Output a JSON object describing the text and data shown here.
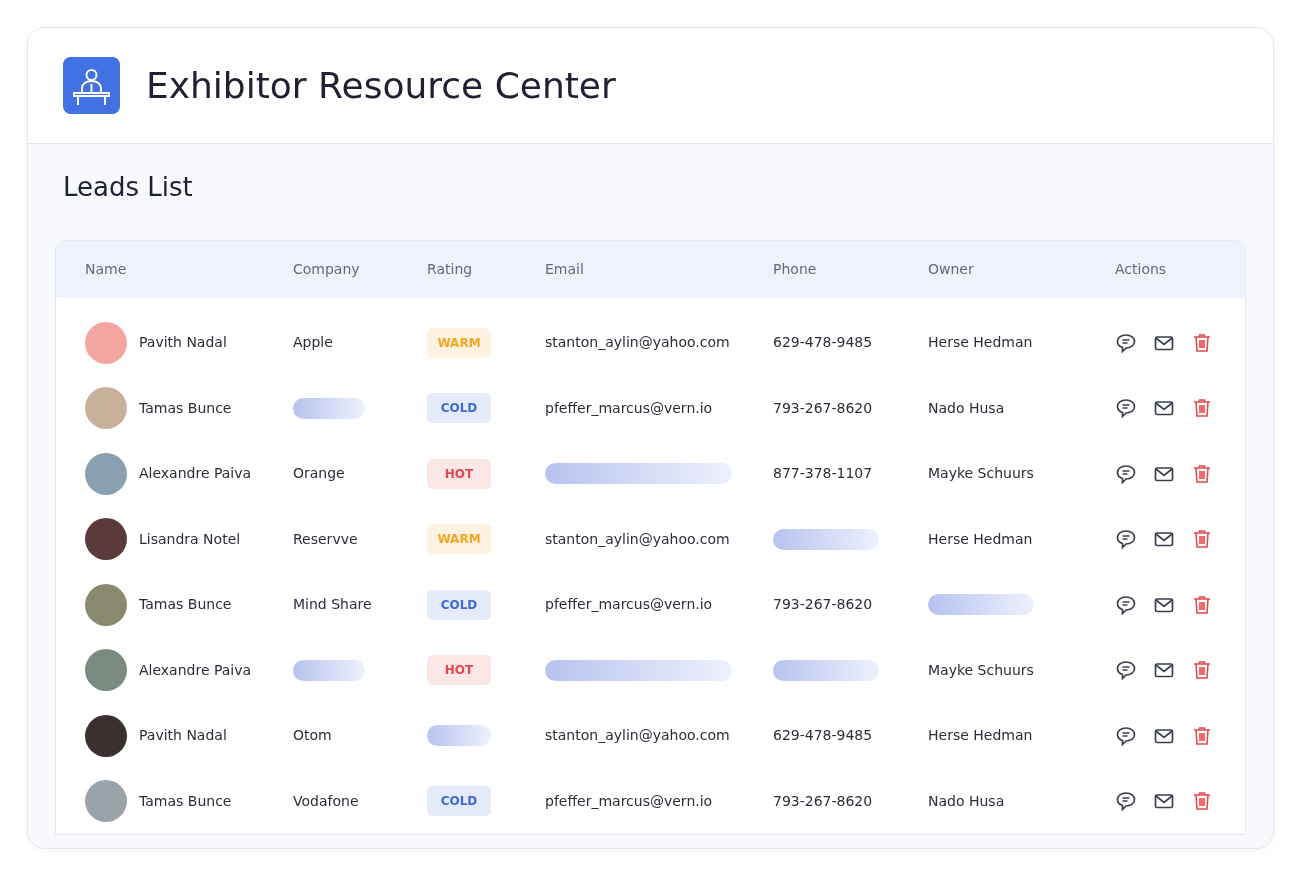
{
  "header": {
    "title": "Exhibitor Resource Center"
  },
  "section": {
    "title": "Leads List"
  },
  "table": {
    "columns": [
      "Name",
      "Company",
      "Rating",
      "Email",
      "Phone",
      "Owner",
      "Actions"
    ],
    "rows": [
      {
        "name": "Pavith Nadal",
        "company": "Apple",
        "rating": {
          "label": "WARM",
          "color": "#f5a623"
        },
        "email": "stanton_aylin@yahoo.com",
        "phone": "629-478-9485",
        "owner": "Herse Hedman"
      },
      {
        "name": "Tamas Bunce",
        "company": null,
        "rating": {
          "label": "COLD",
          "color": "#3d6ad6"
        },
        "email": "pfeffer_marcus@vern.io",
        "phone": "793-267-8620",
        "owner": "Nado Husa"
      },
      {
        "name": "Alexandre Paiva",
        "company": "Orange",
        "rating": {
          "label": "HOT",
          "color": "#e5484d"
        },
        "email": null,
        "phone": "877-378-1107",
        "owner": "Mayke Schuurs"
      },
      {
        "name": "Lisandra Notel",
        "company": "Reservve",
        "rating": {
          "label": "WARM",
          "color": "#f5a623"
        },
        "email": "stanton_aylin@yahoo.com",
        "phone": null,
        "owner": "Herse Hedman"
      },
      {
        "name": "Tamas Bunce",
        "company": "Mind Share",
        "rating": {
          "label": "COLD",
          "color": "#3d6ad6"
        },
        "email": "pfeffer_marcus@vern.io",
        "phone": "793-267-8620",
        "owner": null
      },
      {
        "name": "Alexandre Paiva",
        "company": null,
        "rating": {
          "label": "HOT",
          "color": "#e5484d"
        },
        "email": null,
        "phone": null,
        "owner": "Mayke Schuurs"
      },
      {
        "name": "Pavith Nadal",
        "company": "Otom",
        "rating": null,
        "email": "stanton_aylin@yahoo.com",
        "phone": "629-478-9485",
        "owner": "Herse Hedman"
      },
      {
        "name": "Tamas Bunce",
        "company": "Vodafone",
        "rating": {
          "label": "COLD",
          "color": "#3d6ad6"
        },
        "email": "pfeffer_marcus@vern.io",
        "phone": "793-267-8620",
        "owner": "Nado Husa"
      }
    ]
  }
}
